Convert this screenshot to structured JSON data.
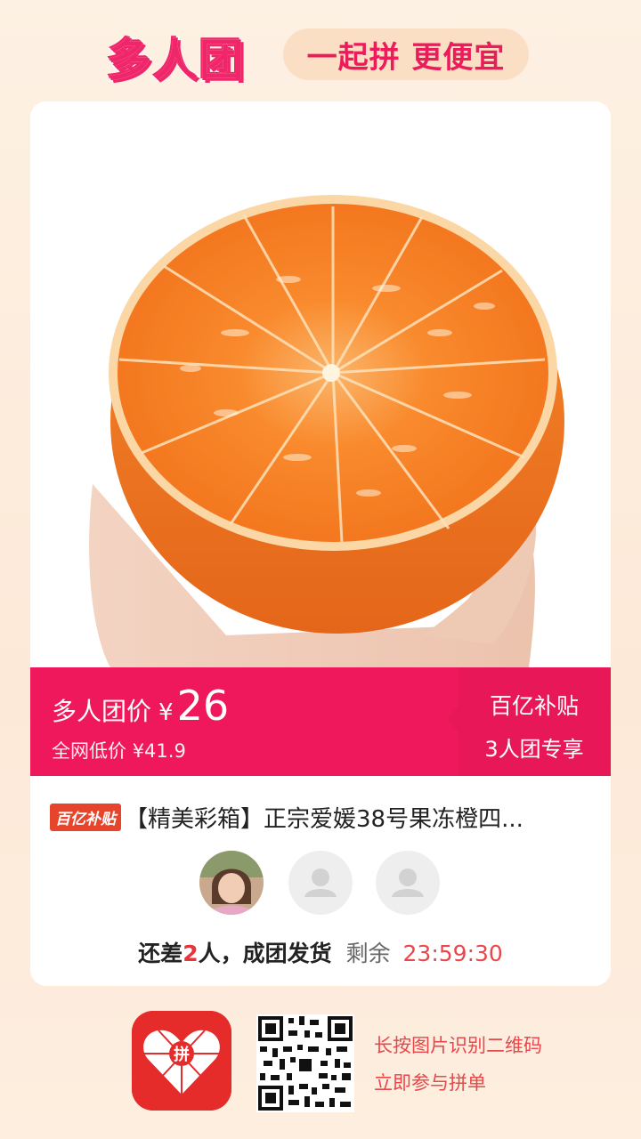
{
  "header": {
    "title": "多人团",
    "slogan": "一起拼 更便宜"
  },
  "product": {
    "image_icon": "orange-photo",
    "price_band": {
      "group_label": "多人团价",
      "currency": "¥",
      "price": "26",
      "original_label": "全网低价",
      "original_price": "¥41.9",
      "subsidy": "百亿补贴",
      "exclusive": "3人团专享"
    },
    "tag": "百亿补贴",
    "title": "【精美彩箱】正宗爱媛38号果冻橙四..."
  },
  "group": {
    "status_prefix": "还差",
    "remaining_count": "2",
    "status_suffix": "人，成团发货",
    "remaining_label": "剩余",
    "timer": "23:59:30"
  },
  "footer": {
    "line1": "长按图片识别二维码",
    "line2": "立即参与拼单"
  },
  "colors": {
    "brand": "#f0185c",
    "accent_red": "#e8474b",
    "background": "#fdf1e3"
  }
}
